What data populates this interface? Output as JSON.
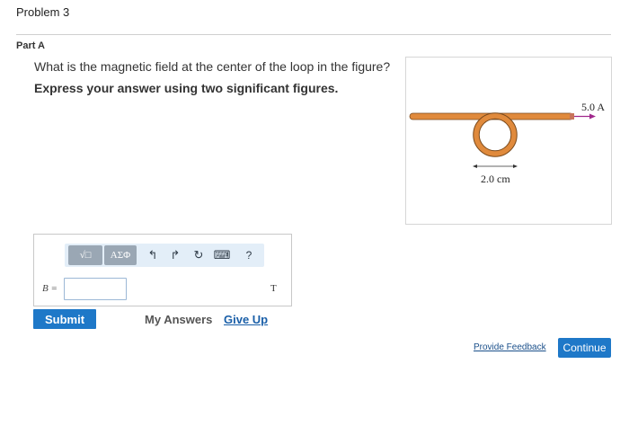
{
  "header": {
    "problem_title": "Problem 3"
  },
  "part": {
    "label": "Part A"
  },
  "question": {
    "text": "What is the magnetic field at the center of the loop in the figure?",
    "instruction": "Express your answer using two significant figures."
  },
  "figure": {
    "current_label": "5.0 A",
    "diameter_label": "2.0 cm",
    "wire_color": "#e08a3c",
    "arrow_color": "#a0288c"
  },
  "toolbar": {
    "template_label": "√□",
    "greek_label": "ΑΣΦ",
    "undo_icon": "↰",
    "redo_icon": "↱",
    "reset_icon": "↻",
    "keyboard_icon": "⌨",
    "help_label": "?"
  },
  "answer": {
    "variable_label": "B =",
    "value": "",
    "unit": "T"
  },
  "actions": {
    "submit_label": "Submit",
    "my_answers_label": "My Answers",
    "give_up_label": "Give Up",
    "feedback_label": "Provide Feedback",
    "continue_label": "Continue"
  }
}
